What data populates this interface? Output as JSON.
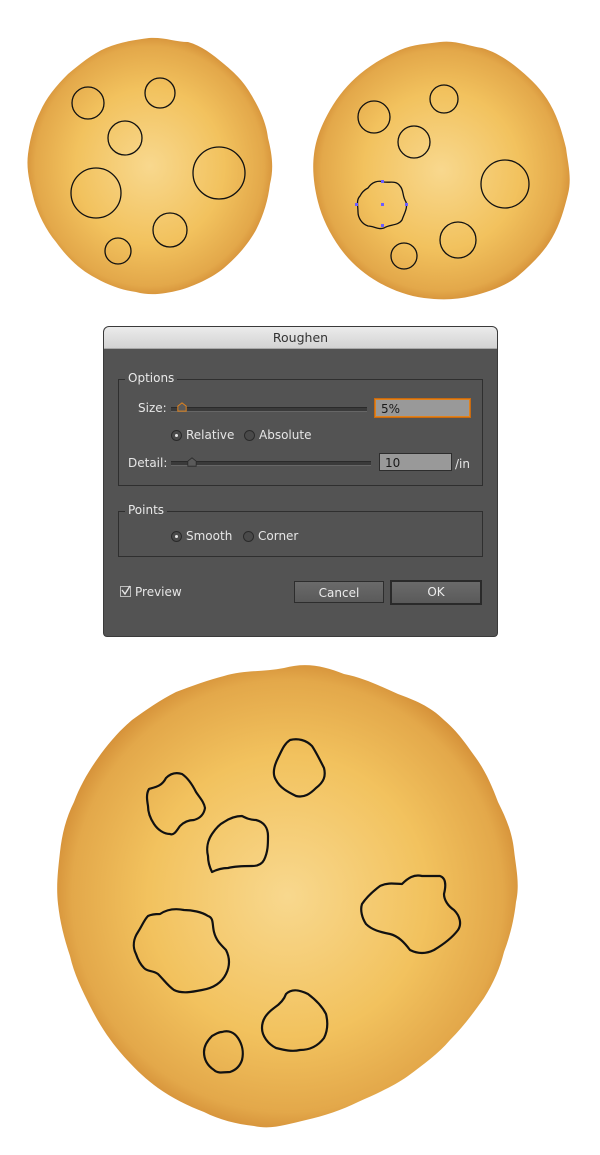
{
  "dialog": {
    "title": "Roughen",
    "options_group": {
      "label": "Options",
      "size_label": "Size:",
      "size_value": "5%",
      "size_slider_fraction": 0.04,
      "mode_options": [
        {
          "label": "Relative",
          "selected": true
        },
        {
          "label": "Absolute",
          "selected": false
        }
      ],
      "detail_label": "Detail:",
      "detail_value": "10",
      "detail_unit": "/in",
      "detail_slider_fraction": 0.1
    },
    "points_group": {
      "label": "Points",
      "options": [
        {
          "label": "Smooth",
          "selected": true
        },
        {
          "label": "Corner",
          "selected": false
        }
      ]
    },
    "preview": {
      "label": "Preview",
      "checked": true
    },
    "cancel_label": "Cancel",
    "ok_label": "OK"
  },
  "colors": {
    "cookie_center": "#f8d88e",
    "cookie_mid": "#f2c25e",
    "cookie_edge": "#c97d2a",
    "chip_outline": "#111111",
    "selection_blue": "#6b5cff",
    "focus_orange": "#e0821d"
  }
}
